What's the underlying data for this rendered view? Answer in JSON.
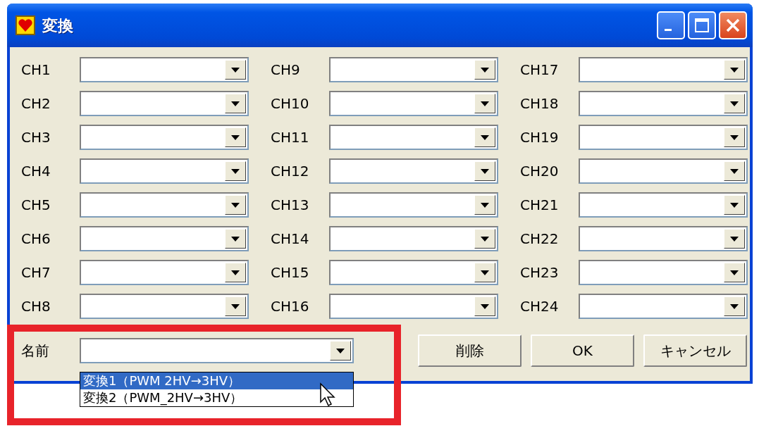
{
  "window": {
    "title": "変換"
  },
  "channel_columns": [
    {
      "channels": [
        {
          "label": "CH1"
        },
        {
          "label": "CH2"
        },
        {
          "label": "CH3"
        },
        {
          "label": "CH4"
        },
        {
          "label": "CH5"
        },
        {
          "label": "CH6"
        },
        {
          "label": "CH7"
        },
        {
          "label": "CH8"
        }
      ]
    },
    {
      "channels": [
        {
          "label": "CH9"
        },
        {
          "label": "CH10"
        },
        {
          "label": "CH11"
        },
        {
          "label": "CH12"
        },
        {
          "label": "CH13"
        },
        {
          "label": "CH14"
        },
        {
          "label": "CH15"
        },
        {
          "label": "CH16"
        }
      ]
    },
    {
      "channels": [
        {
          "label": "CH17"
        },
        {
          "label": "CH18"
        },
        {
          "label": "CH19"
        },
        {
          "label": "CH20"
        },
        {
          "label": "CH21"
        },
        {
          "label": "CH22"
        },
        {
          "label": "CH23"
        },
        {
          "label": "CH24"
        }
      ]
    }
  ],
  "name_field": {
    "label": "名前",
    "expanded": true,
    "options": [
      {
        "text": "変換1（PWM 2HV→3HV）",
        "selected": true
      },
      {
        "text": "変換2（PWM_2HV→3HV）",
        "selected": false
      }
    ]
  },
  "buttons": [
    "削除",
    "OK",
    "キャンセル"
  ]
}
